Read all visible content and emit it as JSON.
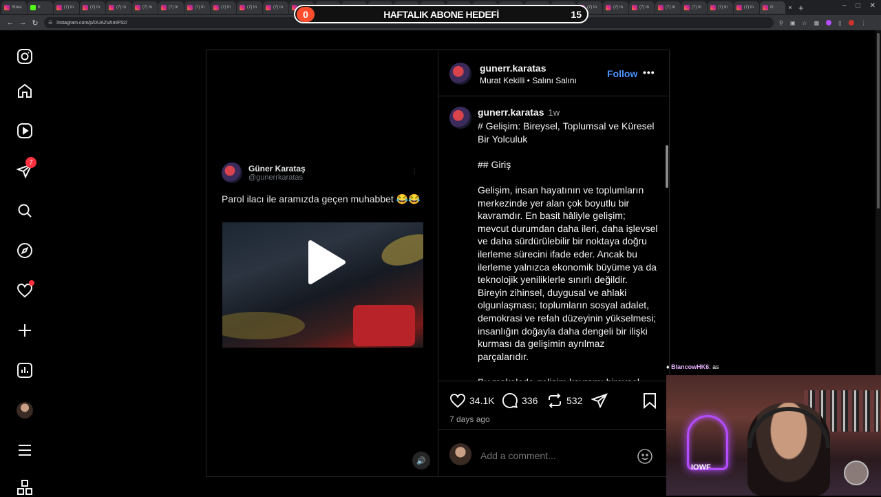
{
  "browser": {
    "tab_labels": [
      "Strea",
      "K",
      "(7) In",
      "(7) In",
      "(7) In",
      "(7) In",
      "(7) In",
      "(7) In",
      "(7) In",
      "(7) In",
      "(7) In",
      "(7) In",
      "(7) In",
      "(7) In",
      "(7) In",
      "(7) In",
      "(7) In",
      "(7) In",
      "(7) In",
      "(7) In",
      "(7) In",
      "(7) In",
      "(7) In",
      "(7) In",
      "(7) In",
      "(7) In",
      "(7) In",
      "(7) In",
      "(7) In",
      "G"
    ],
    "url": "instagram.com/p/DUA2VAmiF52/"
  },
  "goal_overlay": {
    "title": "HAFTALIK ABONE HEDEFİ",
    "current": "0",
    "target": "15",
    "progress_fraction": 0.0
  },
  "sidebar": {
    "notifications_badge": "7",
    "items": [
      "instagram-logo",
      "home-icon",
      "reels-icon",
      "messages-icon",
      "search-icon",
      "explore-icon",
      "notifications-icon",
      "create-icon",
      "dashboard-icon",
      "profile-avatar",
      "more-menu-icon",
      "also-from-meta-icon"
    ]
  },
  "media": {
    "tweet": {
      "name": "Güner Karataş",
      "handle": "@gunerrkaratas",
      "text": "Parol ilacı ile aramızda geçen muhabbet 😂😂"
    }
  },
  "post": {
    "username": "gunerr.karatas",
    "audio": "Murat Kekilli • Salını Salını",
    "follow_label": "Follow",
    "caption": {
      "username": "gunerr.karatas",
      "time": "1w",
      "body": "# Gelişim: Bireysel, Toplumsal ve Küresel Bir Yolculuk\n\n## Giriş\n\nGelişim, insan hayatının ve toplumların merkezinde yer alan çok boyutlu bir kavramdır. En basit hâliyle gelişim; mevcut durumdan daha ileri, daha işlevsel ve daha sürdürülebilir bir noktaya doğru ilerleme sürecini ifade eder. Ancak bu ilerleme yalnızca ekonomik büyüme ya da teknolojik yeniliklerle sınırlı değildir. Bireyin zihinsel, duygusal ve ahlaki olgunlaşması; toplumların sosyal adalet, demokrasi ve refah düzeyinin yükselmesi; insanlığın doğayla daha dengeli bir ilişki kurması da gelişimin ayrılmaz parçalarıdır.\n\nBu makalede gelişim kavramı bireysel"
    },
    "likes": "34.1K",
    "comments": "336",
    "reposts": "532",
    "posted_ago": "7 days ago",
    "comment_placeholder": "Add a comment..."
  },
  "stream": {
    "chat_user": "BlancowHK6",
    "chat_message": ": as",
    "webcam_sign": "IOWF"
  }
}
